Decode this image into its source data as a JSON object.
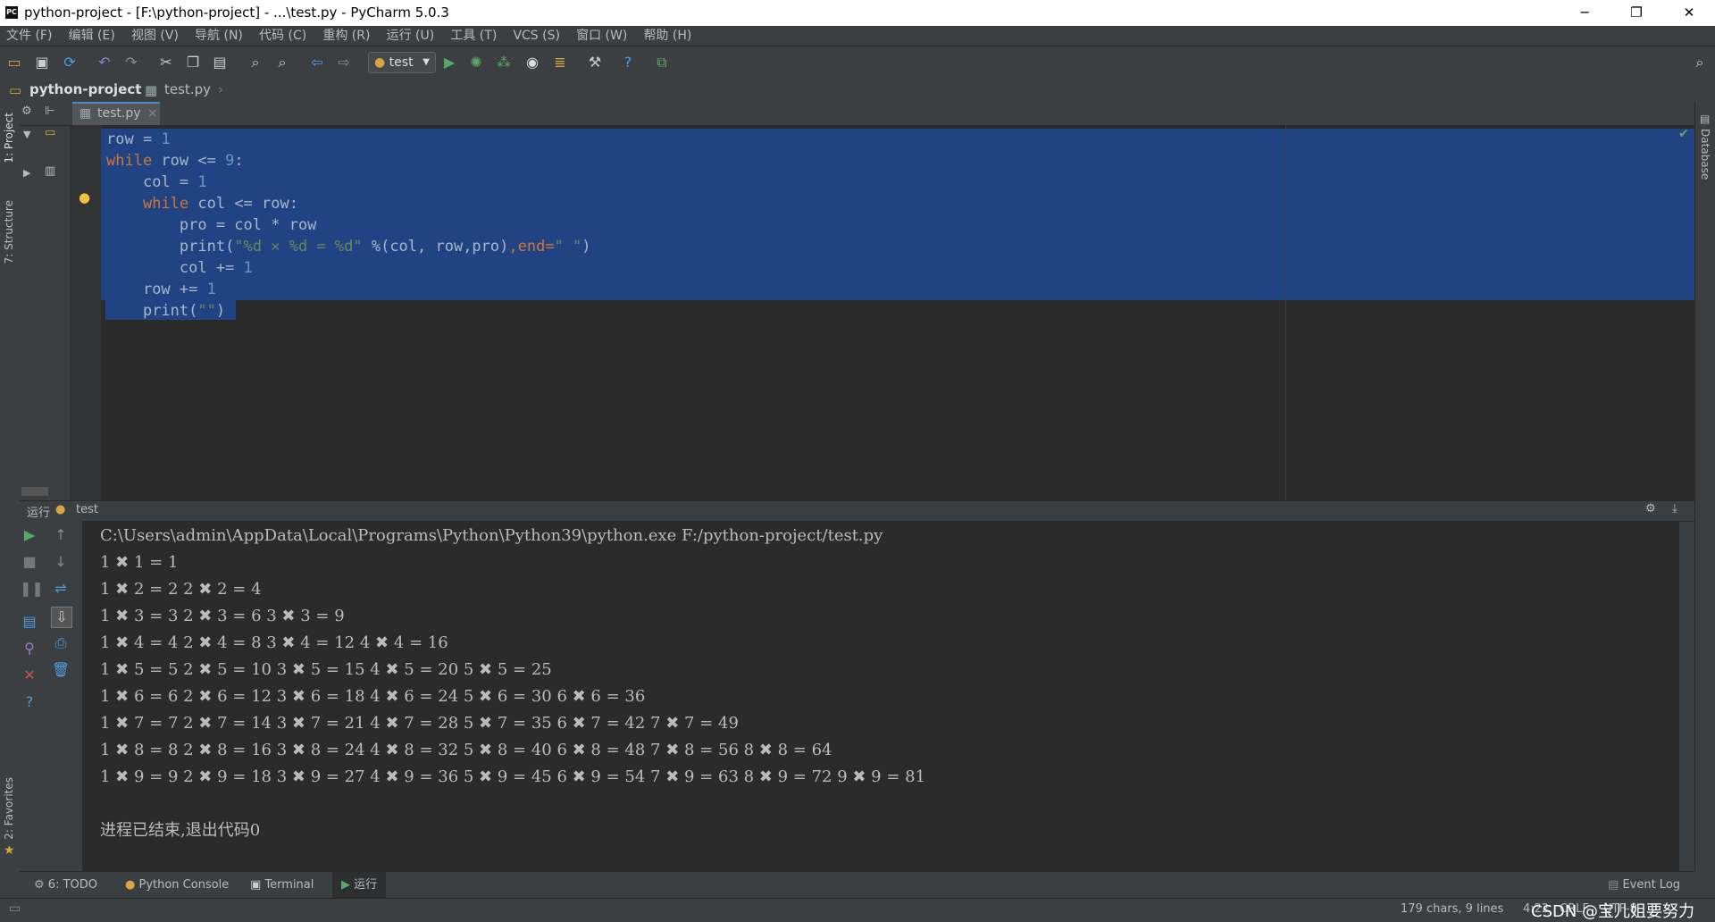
{
  "window": {
    "title": "python-project - [F:\\python-project] - ...\\test.py - PyCharm 5.0.3",
    "logo_text": "PC",
    "minimize": "─",
    "restore": "❐",
    "close": "✕"
  },
  "menu": [
    "文件 (F)",
    "编辑 (E)",
    "视图 (V)",
    "导航 (N)",
    "代码 (C)",
    "重构 (R)",
    "运行 (U)",
    "工具 (T)",
    "VCS (S)",
    "窗口 (W)",
    "帮助 (H)"
  ],
  "toolbar": {
    "run_config_label": "test",
    "icons": [
      "open-folder-icon",
      "save-icon",
      "sync-icon",
      "undo-icon",
      "redo-icon",
      "cut-icon",
      "copy-icon",
      "paste-icon",
      "find-icon",
      "replace-icon",
      "back-icon",
      "forward-icon",
      "run-icon",
      "debug-icon",
      "coverage-icon",
      "profile-icon",
      "concurrency-icon",
      "settings-icon",
      "help-icon",
      "sdk-icon",
      "search-icon"
    ]
  },
  "navbar": {
    "project": "python-project",
    "file": "test.py"
  },
  "left_strip": {
    "project_label": "1: Project",
    "structure_label": "7: Structure",
    "favorites_label": "2: Favorites"
  },
  "right_strip": {
    "database_label": "Database"
  },
  "editor_tab": {
    "label": "test.py",
    "close": "×"
  },
  "code_lines": [
    {
      "indent": "",
      "tokens": [
        [
          "row = ",
          "fn"
        ],
        [
          "1",
          "num"
        ]
      ]
    },
    {
      "indent": "",
      "tokens": [
        [
          "while",
          "kw"
        ],
        [
          " row <= ",
          "fn"
        ],
        [
          "9",
          "num"
        ],
        [
          ":",
          "fn"
        ]
      ]
    },
    {
      "indent": "    ",
      "tokens": [
        [
          "col = ",
          "fn"
        ],
        [
          "1",
          "num"
        ]
      ]
    },
    {
      "indent": "    ",
      "tokens": [
        [
          "while",
          "kw"
        ],
        [
          " col <= row:",
          "fn"
        ]
      ]
    },
    {
      "indent": "        ",
      "tokens": [
        [
          "pro = col * row",
          "fn"
        ]
      ]
    },
    {
      "indent": "        ",
      "tokens": [
        [
          "print(",
          "fn"
        ],
        [
          "\"%d ✕ %d = %d\"",
          "str"
        ],
        [
          " %(col, row,pro)",
          "fn"
        ],
        [
          ",",
          "kw"
        ],
        [
          "end=",
          "kw"
        ],
        [
          "\" \"",
          "str"
        ],
        [
          ")",
          "fn"
        ]
      ]
    },
    {
      "indent": "        ",
      "tokens": [
        [
          "col += ",
          "fn"
        ],
        [
          "1",
          "num"
        ]
      ]
    },
    {
      "indent": "    ",
      "tokens": [
        [
          "row += ",
          "fn"
        ],
        [
          "1",
          "num"
        ]
      ]
    },
    {
      "indent": "    ",
      "tokens": [
        [
          "print(",
          "fn"
        ],
        [
          "\"\"",
          "str"
        ],
        [
          ")",
          "fn"
        ]
      ]
    }
  ],
  "run_panel": {
    "header_label": "运行",
    "config_name": "test",
    "output_lines": [
      "C:\\Users\\admin\\AppData\\Local\\Programs\\Python\\Python39\\python.exe F:/python-project/test.py",
      "1 ✖ 1 = 1",
      "1 ✖ 2 = 2 2 ✖ 2 = 4",
      "1 ✖ 3 = 3 2 ✖ 3 = 6 3 ✖ 3 = 9",
      "1 ✖ 4 = 4 2 ✖ 4 = 8 3 ✖ 4 = 12 4 ✖ 4 = 16",
      "1 ✖ 5 = 5 2 ✖ 5 = 10 3 ✖ 5 = 15 4 ✖ 5 = 20 5 ✖ 5 = 25",
      "1 ✖ 6 = 6 2 ✖ 6 = 12 3 ✖ 6 = 18 4 ✖ 6 = 24 5 ✖ 6 = 30 6 ✖ 6 = 36",
      "1 ✖ 7 = 7 2 ✖ 7 = 14 3 ✖ 7 = 21 4 ✖ 7 = 28 5 ✖ 7 = 35 6 ✖ 7 = 42 7 ✖ 7 = 49",
      "1 ✖ 8 = 8 2 ✖ 8 = 16 3 ✖ 8 = 24 4 ✖ 8 = 32 5 ✖ 8 = 40 6 ✖ 8 = 48 7 ✖ 8 = 56 8 ✖ 8 = 64",
      "1 ✖ 9 = 9 2 ✖ 9 = 18 3 ✖ 9 = 27 4 ✖ 9 = 36 5 ✖ 9 = 45 6 ✖ 9 = 54 7 ✖ 9 = 63 8 ✖ 9 = 72 9 ✖ 9 = 81",
      "",
      "进程已结束,退出代码0"
    ]
  },
  "bottom_tabs": {
    "todo": "6: TODO",
    "python_console": "Python Console",
    "terminal": "Terminal",
    "run": "运行",
    "event_log": "Event Log"
  },
  "status": {
    "chars": "179 chars, 9 lines",
    "position": "4:22",
    "line_sep": "CRLF",
    "encoding": "UTF-8",
    "watermark": "CSDN @宝儿姐要努力"
  },
  "colors": {
    "selection": "#214283",
    "keyword": "#cc7832",
    "number": "#6897bb",
    "string": "#6a8759",
    "run_green": "#59a869",
    "stop_red": "#c75450"
  }
}
